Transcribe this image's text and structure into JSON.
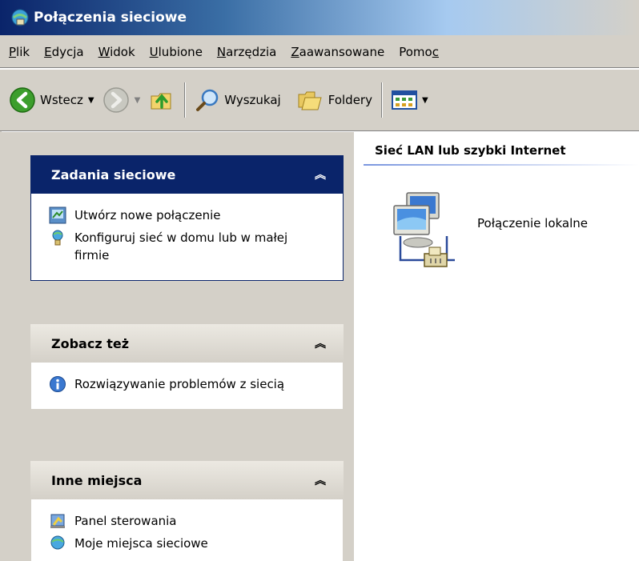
{
  "window": {
    "title": "Połączenia sieciowe",
    "icon": "network-connections-icon"
  },
  "menu": {
    "items": [
      {
        "key": "P",
        "rest": "lik"
      },
      {
        "key": "E",
        "rest": "dycja"
      },
      {
        "key": "W",
        "rest": "idok"
      },
      {
        "key": "U",
        "rest": "lubione"
      },
      {
        "key": "N",
        "rest": "arzędzia"
      },
      {
        "key": "Z",
        "rest": "aawansowane"
      },
      {
        "pre": "Pomo",
        "key": "c",
        "rest": ""
      }
    ]
  },
  "toolbar": {
    "back_label": "Wstecz",
    "search_label": "Wyszukaj",
    "folders_label": "Foldery"
  },
  "taskpane": {
    "network_tasks": {
      "title": "Zadania sieciowe",
      "items": [
        {
          "label": "Utwórz nowe połączenie",
          "icon": "new-connection-icon"
        },
        {
          "label": "Konfiguruj sieć w domu lub w małej firmie",
          "icon": "home-network-wizard-icon"
        }
      ]
    },
    "see_also": {
      "title": "Zobacz też",
      "items": [
        {
          "label": "Rozwiązywanie problemów z siecią",
          "icon": "info-icon"
        }
      ]
    },
    "other_places": {
      "title": "Inne miejsca",
      "items": [
        {
          "label": "Panel sterowania",
          "icon": "control-panel-icon"
        },
        {
          "label": "Moje miejsca sieciowe",
          "icon": "my-network-places-icon"
        }
      ]
    }
  },
  "main": {
    "group_title": "Sieć LAN lub szybki Internet",
    "connections": [
      {
        "label": "Połączenie lokalne",
        "icon": "lan-connection-icon"
      }
    ]
  },
  "colors": {
    "selected_header": "#0a246a",
    "pane_bg": "#d4d0c8",
    "accent_line": "#7a96df"
  }
}
